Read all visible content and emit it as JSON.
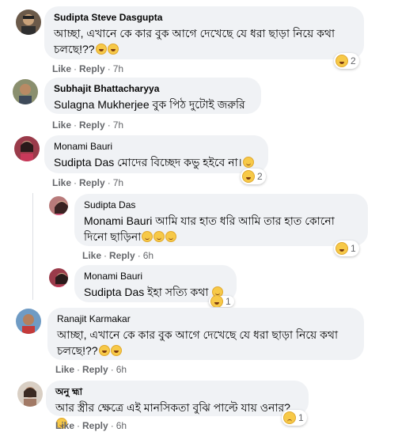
{
  "comments": [
    {
      "author": "Sudipta Steve Dasgupta",
      "text": "আচ্ছা, এখানে কে কার বুক আগে দেখেছে যে ধরা ছাড়া নিয়ে কথা চলছে!??",
      "reaction_count": "2",
      "time": "7h"
    },
    {
      "author": "Subhajit Bhattacharyya",
      "mention": "Sulagna Mukherjee",
      "text": "বুক পিঠ দুটোই জরুরি",
      "time": "7h"
    },
    {
      "author": "Monami Bauri",
      "mention": "Sudipta Das",
      "text": "মোদের বিচ্ছেদ কভু হইবে না।",
      "reaction_count": "2",
      "time": "7h"
    },
    {
      "author": "Sudipta Das",
      "mention": "Monami Bauri",
      "text": "আমি যার হাত ধরি আমি তার হাত কোনো দিনো ছাড়িনা",
      "reaction_count": "1",
      "time": "6h"
    },
    {
      "author": "Monami Bauri",
      "mention": "Sudipta Das",
      "text": "ইহা সত্যি কথা",
      "reaction_count": "1"
    },
    {
      "author": "Ranajit Karmakar",
      "text": "আচ্ছা, এখানে কে কার বুক আগে দেখেছে যে ধরা ছাড়া নিয়ে কথা চলছে!??",
      "time": "6h"
    },
    {
      "author": "অনু হ্মা",
      "text": "আর স্ত্রীর ক্ষেত্রে এই মানসিকতা বুঝি পাল্টে যায় ওনার?",
      "reaction_count": "1",
      "time": "6h"
    }
  ],
  "actions": {
    "like": "Like",
    "reply": "Reply",
    "dot": "·"
  },
  "colors": {
    "bubble": "#f0f2f5",
    "meta": "#65676b",
    "text": "#050505"
  }
}
